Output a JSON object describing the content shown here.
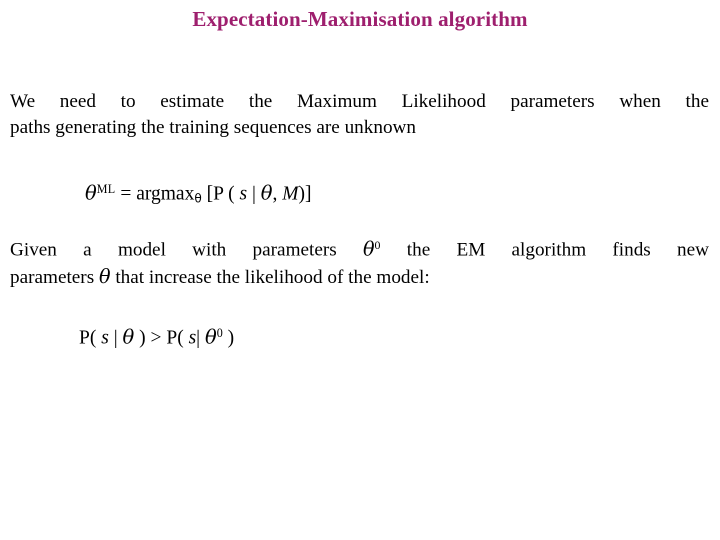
{
  "slide": {
    "title": "Expectation-Maximisation algorithm",
    "title_color": "#9E1F6E",
    "background_color": "#FFFFFF",
    "text_color": "#000000"
  },
  "paragraph1": {
    "line1": "We need to estimate the Maximum Likelihood parameters when the",
    "line2": "paths generating the training sequences are unknown",
    "full_text": "We need to estimate the Maximum Likelihood parameters when the paths generating the training sequences are unknown"
  },
  "formula1": {
    "theta": "θ",
    "superscript": "ML",
    "equals": "=",
    "argmax": "argmax",
    "argmax_subscript": "θ",
    "open_bracket": "[",
    "p": "P",
    "open_paren": "(",
    "observation": "s",
    "given": "|",
    "theta2": "θ",
    "comma": ",",
    "model": "M",
    "close_paren": ")",
    "close_bracket": "]",
    "full_text": "θML = argmaxθ [P ( s | θ, M)]"
  },
  "paragraph2": {
    "line1_a": "Given a model with parameters ",
    "line1_theta": "θ",
    "line1_sup": "0",
    "line1_b": " the EM algorithm finds new",
    "line2_a": "parameters ",
    "line2_theta": "θ",
    "line2_b": " that increase the likelihood of the model:",
    "full_text": "Given a model with parameters θ0 the EM algorithm finds new parameters θ that increase the likelihood of the model:"
  },
  "formula2": {
    "p1": "P(",
    "observation1": "s",
    "given1": "|",
    "theta1": "θ",
    "close1": ")",
    "operator": ">",
    "p2": "P(",
    "observation2": "s",
    "given2": "|",
    "theta2": "θ",
    "sup2": "0",
    "close2": ")",
    "full_text": "P( s | θ ) > P( s| θ0 )"
  }
}
